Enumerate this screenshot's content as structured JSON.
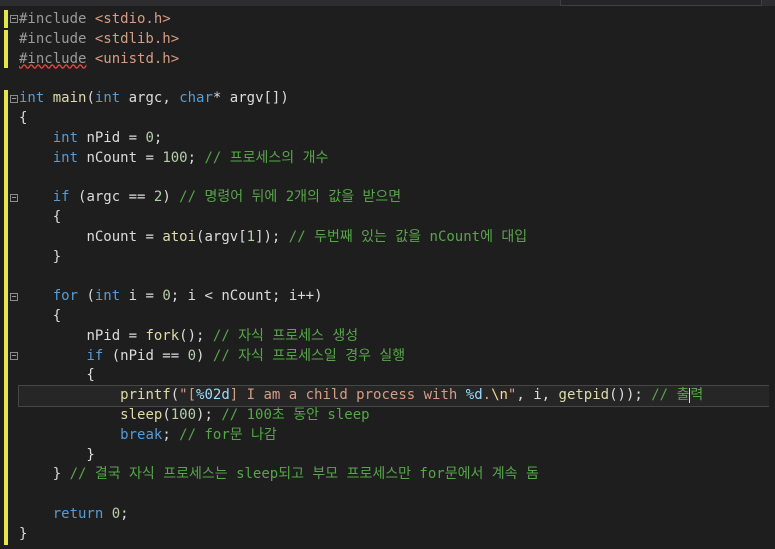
{
  "editor": {
    "includes": [
      "#include <stdio.h>",
      "#include <stdlib.h>",
      "#include <unistd.h>"
    ],
    "main_sig": {
      "ret": "int",
      "name": "main",
      "p1t": "int",
      "p1": "argc",
      "p2t": "char*",
      "p2": "argv[]"
    },
    "decl1": {
      "t": "int",
      "v": "nPid",
      "val": "0"
    },
    "decl2": {
      "t": "int",
      "v": "nCount",
      "val": "100",
      "cmt": "// 프로세스의 개수"
    },
    "if1": {
      "kw": "if",
      "cond": "argc",
      "num": "2",
      "cmt": "// 명령어 뒤에 2개의 값을 받으면"
    },
    "assign1": {
      "v": "nCount",
      "fn": "atoi",
      "arg": "argv",
      "idx": "1",
      "cmt": "// 두번째 있는 값을 nCount에 대입"
    },
    "for1": {
      "kw": "for",
      "t": "int",
      "i": "i",
      "z": "0",
      "i2": "i",
      "lim": "nCount",
      "inc": "i++"
    },
    "fork1": {
      "v": "nPid",
      "fn": "fork",
      "cmt": "// 자식 프로세스 생성"
    },
    "if2": {
      "kw": "if",
      "v": "nPid",
      "z": "0",
      "cmt": "// 자식 프로세스일 경우 실행"
    },
    "printf1": {
      "fn": "printf",
      "s_open": "\"[",
      "f1": "%02d",
      "s_mid": "] I am a child process with ",
      "f2": "%d",
      "s_dot": ".",
      "esc": "\\n",
      "s_close": "\"",
      "a1": "i",
      "fn2": "getpid",
      "cmt_a": "// 출",
      "cmt_b": "력"
    },
    "sleep1": {
      "fn": "sleep",
      "arg": "100",
      "cmt": "// 100초 동안 sleep"
    },
    "break1": {
      "kw": "break",
      "cmt": "// for문 나감"
    },
    "close_cmt": "// 결국 자식 프로세스는 sleep되고 부모 프로세스만 for문에서 계속 돔",
    "ret": {
      "kw": "return",
      "val": "0"
    }
  }
}
